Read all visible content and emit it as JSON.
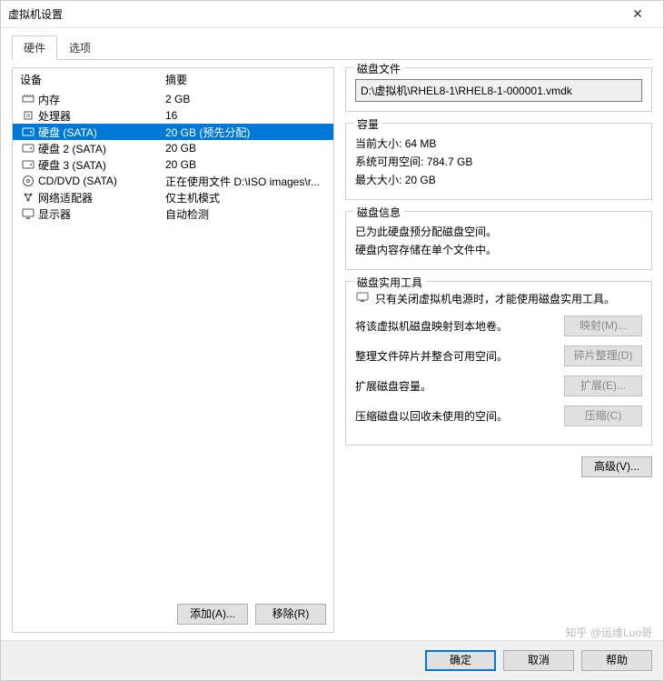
{
  "window": {
    "title": "虚拟机设置"
  },
  "tabs": [
    {
      "label": "硬件",
      "active": true
    },
    {
      "label": "选项",
      "active": false
    }
  ],
  "hw_header": {
    "device": "设备",
    "summary": "摘要"
  },
  "hardware": [
    {
      "icon": "memory",
      "name": "内存",
      "summary": "2 GB",
      "selected": false
    },
    {
      "icon": "cpu",
      "name": "处理器",
      "summary": "16",
      "selected": false
    },
    {
      "icon": "disk",
      "name": "硬盘 (SATA)",
      "summary": "20 GB (预先分配)",
      "selected": true
    },
    {
      "icon": "disk",
      "name": "硬盘 2 (SATA)",
      "summary": "20 GB",
      "selected": false
    },
    {
      "icon": "disk",
      "name": "硬盘 3 (SATA)",
      "summary": "20 GB",
      "selected": false
    },
    {
      "icon": "cd",
      "name": "CD/DVD (SATA)",
      "summary": "正在使用文件 D:\\ISO images\\r...",
      "selected": false
    },
    {
      "icon": "net",
      "name": "网络适配器",
      "summary": "仅主机模式",
      "selected": false
    },
    {
      "icon": "display",
      "name": "显示器",
      "summary": "自动检测",
      "selected": false
    }
  ],
  "left_buttons": {
    "add": "添加(A)...",
    "remove": "移除(R)"
  },
  "disk_file": {
    "title": "磁盘文件",
    "path": "D:\\虚拟机\\RHEL8-1\\RHEL8-1-000001.vmdk"
  },
  "capacity": {
    "title": "容量",
    "current_label": "当前大小:",
    "current_value": "64 MB",
    "free_label": "系统可用空间:",
    "free_value": "784.7 GB",
    "max_label": "最大大小:",
    "max_value": "20 GB"
  },
  "disk_info": {
    "title": "磁盘信息",
    "line1": "已为此硬盘预分配磁盘空间。",
    "line2": "硬盘内容存储在单个文件中。"
  },
  "utilities": {
    "title": "磁盘实用工具",
    "warning": "只有关闭虚拟机电源时，才能使用磁盘实用工具。",
    "map_desc": "将该虚拟机磁盘映射到本地卷。",
    "map_btn": "映射(M)...",
    "defrag_desc": "整理文件碎片并整合可用空间。",
    "defrag_btn": "碎片整理(D)",
    "expand_desc": "扩展磁盘容量。",
    "expand_btn": "扩展(E)...",
    "compact_desc": "压缩磁盘以回收未使用的空间。",
    "compact_btn": "压缩(C)"
  },
  "advanced_btn": "高级(V)...",
  "footer": {
    "ok": "确定",
    "cancel": "取消",
    "help": "帮助"
  },
  "watermark": "知乎 @运维Luo哥"
}
